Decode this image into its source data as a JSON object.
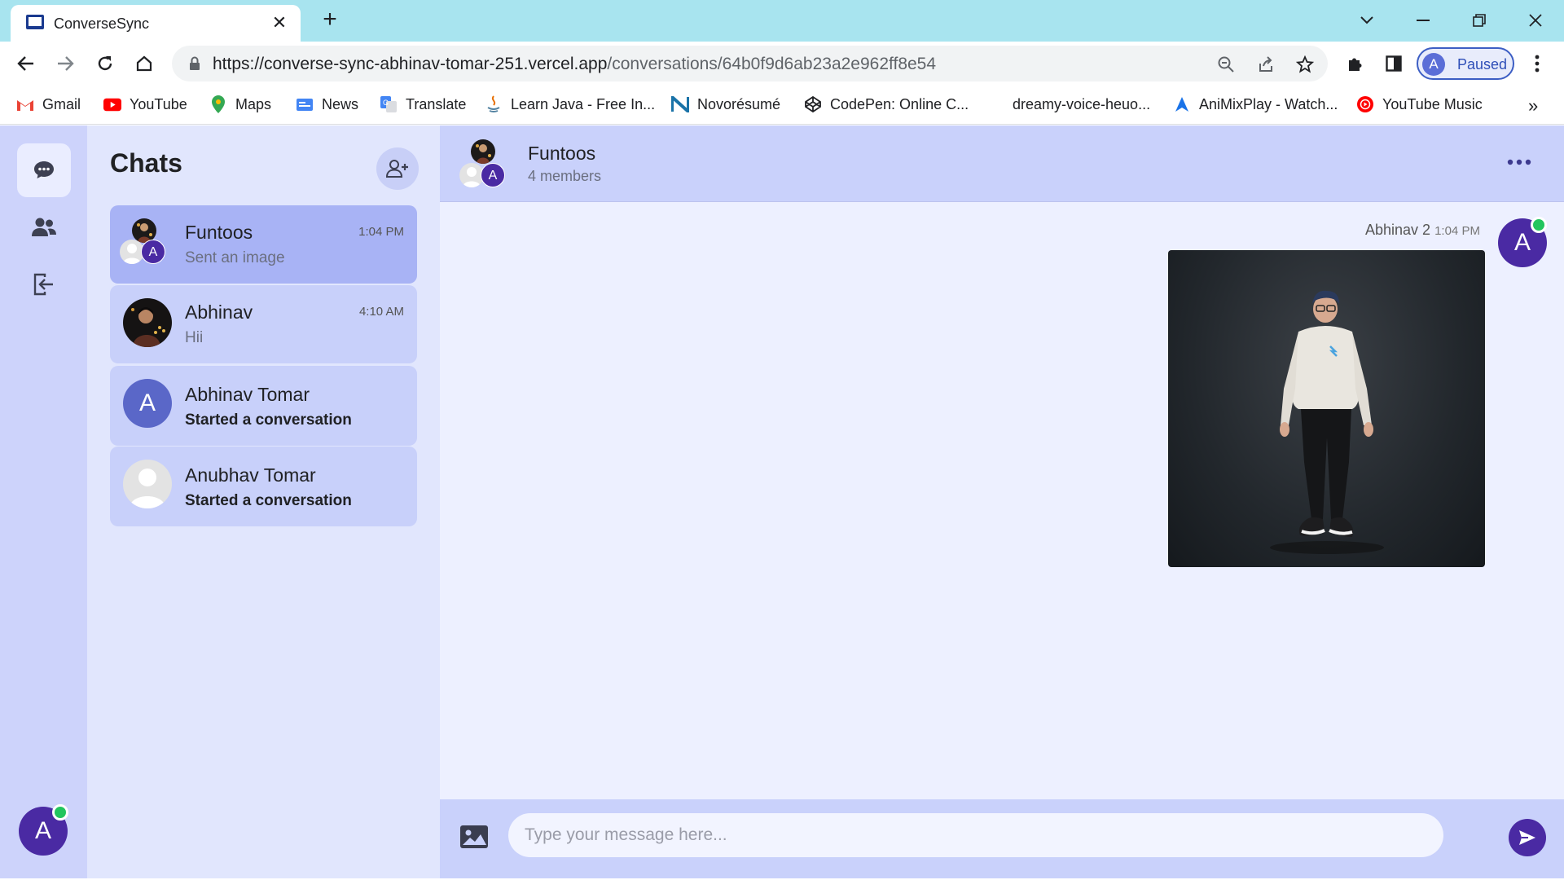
{
  "browser": {
    "tab_title": "ConverseSync",
    "url_host": "https://converse-sync-abhinav-tomar-251.vercel.app",
    "url_path": "/conversations/64b0f9d6ab23a2e962ff8e54",
    "profile_initial": "A",
    "profile_status": "Paused",
    "bookmarks": [
      {
        "label": "Gmail",
        "icon": "gmail-icon"
      },
      {
        "label": "YouTube",
        "icon": "youtube-icon"
      },
      {
        "label": "Maps",
        "icon": "maps-icon"
      },
      {
        "label": "News",
        "icon": "news-icon"
      },
      {
        "label": "Translate",
        "icon": "translate-icon"
      },
      {
        "label": "Learn Java - Free In...",
        "icon": "java-icon"
      },
      {
        "label": "Novorésumé",
        "icon": "novoresume-icon"
      },
      {
        "label": "CodePen: Online C...",
        "icon": "codepen-icon"
      },
      {
        "label": "dreamy-voice-heuo...",
        "icon": ""
      },
      {
        "label": "AniMixPlay - Watch...",
        "icon": "animixplay-icon"
      },
      {
        "label": "YouTube Music",
        "icon": "youtube-music-icon"
      }
    ],
    "more_bookmarks": "»"
  },
  "app": {
    "user_initial": "A",
    "chats_title": "Chats",
    "chats": [
      {
        "name": "Funtoos",
        "subtitle": "Sent an image",
        "time": "1:04 PM",
        "avatar": "group",
        "group_letter": "A"
      },
      {
        "name": "Abhinav",
        "subtitle": "Hii",
        "time": "4:10 AM",
        "avatar": "photo"
      },
      {
        "name": "Abhinav Tomar",
        "subtitle": "Started a conversation",
        "time": "",
        "avatar": "letter",
        "letter": "A"
      },
      {
        "name": "Anubhav Tomar",
        "subtitle": "Started a conversation",
        "time": "",
        "avatar": "default"
      }
    ],
    "conversation": {
      "title": "Funtoos",
      "members": "4 members",
      "header_letter": "A",
      "message": {
        "sender": "Abhinav 2",
        "time": "1:04 PM",
        "avatar_letter": "A",
        "content": "image"
      },
      "input_placeholder": "Type your message here..."
    }
  },
  "colors": {
    "rail": "#cdd3fb",
    "panel": "#e1e6fd",
    "active_chat": "#a8b3f5",
    "accent": "#4a2aa3",
    "online": "#22c55e"
  }
}
